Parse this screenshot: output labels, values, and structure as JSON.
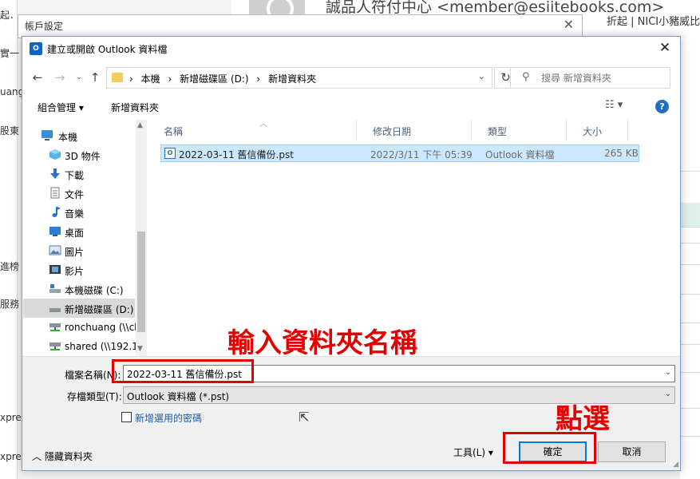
{
  "background": {
    "left_fragments": [
      "起．",
      "實一",
      "uang",
      "股東",
      "進榜",
      "服務",
      "xpre",
      "xpres"
    ],
    "email": "誠品人符付中心 <member@esiitebooks.com>",
    "promo": "折起 | NICI小豬威比獨家"
  },
  "account_dialog": {
    "title": "帳戶設定",
    "close_icon": "close-icon"
  },
  "dialog": {
    "title": "建立或開啟 Outlook 資料檔",
    "app_icon_label": "O",
    "close_label": "✕"
  },
  "address_bar": {
    "crumbs": [
      "本機",
      "新增磁碟區 (D:)",
      "新增資料夾"
    ],
    "search_placeholder": "搜尋 新增資料夾"
  },
  "toolbar": {
    "organize": "組合管理 ▾",
    "new_folder": "新增資料夾"
  },
  "nav": {
    "items": [
      {
        "label": "本機",
        "icon": "computer-icon"
      },
      {
        "label": "3D 物件",
        "icon": "cube-icon"
      },
      {
        "label": "下載",
        "icon": "download-icon"
      },
      {
        "label": "文件",
        "icon": "document-icon"
      },
      {
        "label": "音樂",
        "icon": "music-icon"
      },
      {
        "label": "桌面",
        "icon": "desktop-icon"
      },
      {
        "label": "圖片",
        "icon": "picture-icon"
      },
      {
        "label": "影片",
        "icon": "video-icon"
      },
      {
        "label": "本機磁碟 (C:)",
        "icon": "drive-icon"
      },
      {
        "label": "新增磁碟區 (D:)",
        "icon": "drive-icon"
      },
      {
        "label": "ronchuang (\\\\cl",
        "icon": "network-drive-icon"
      },
      {
        "label": "shared (\\\\192.1",
        "icon": "network-drive-icon"
      }
    ]
  },
  "columns": {
    "name": "名稱",
    "date": "修改日期",
    "type": "類型",
    "size": "大小"
  },
  "files": [
    {
      "name": "2022-03-11 舊信備份.pst",
      "date": "2022/3/11 下午 05:39",
      "type": "Outlook 資料檔",
      "size": "265 KB"
    }
  ],
  "form": {
    "filename_label": "檔案名稱(N):",
    "filename_value": "2022-03-11 舊信備份.pst",
    "filetype_label": "存檔類型(T):",
    "filetype_value": "Outlook 資料檔 (*.pst)",
    "password_checkbox": "新增選用的密碼",
    "hide_folders": "隱藏資料夾",
    "tools": "工具(L)",
    "ok": "確定",
    "cancel": "取消"
  },
  "annotations": {
    "type_name": "輸入資料夾名稱",
    "click": "點選",
    "color": "#e30000"
  }
}
